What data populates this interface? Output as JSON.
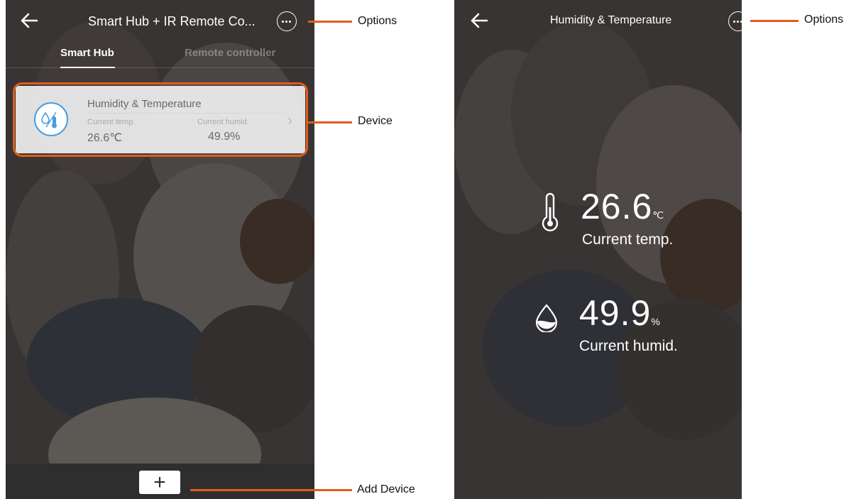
{
  "left_screen": {
    "title": "Smart Hub + IR Remote Co...",
    "tabs": [
      {
        "label": "Smart Hub",
        "active": true
      },
      {
        "label": "Remote controller",
        "active": false
      }
    ],
    "device": {
      "name": "Humidity & Temperature",
      "temp_label": "Current temp.",
      "temp_value": "26.6℃",
      "humid_label": "Current humid.",
      "humid_value": "49.9%"
    },
    "add_button": "+"
  },
  "right_screen": {
    "title": "Humidity & Temperature",
    "temp": {
      "value": "26.6",
      "unit": "℃",
      "label": "Current temp."
    },
    "humid": {
      "value": "49.9",
      "unit": "%",
      "label": "Current humid."
    }
  },
  "callouts": {
    "options": "Options",
    "device": "Device",
    "add_device": "Add Device",
    "options_right": "Options"
  },
  "colors": {
    "accent": "#e35c1c",
    "icon_blue": "#4a9de0"
  },
  "icons": [
    "back-arrow-icon",
    "more-options-icon",
    "humidity-temperature-icon",
    "chevron-right-icon",
    "plus-icon",
    "thermometer-icon",
    "water-drop-icon"
  ]
}
